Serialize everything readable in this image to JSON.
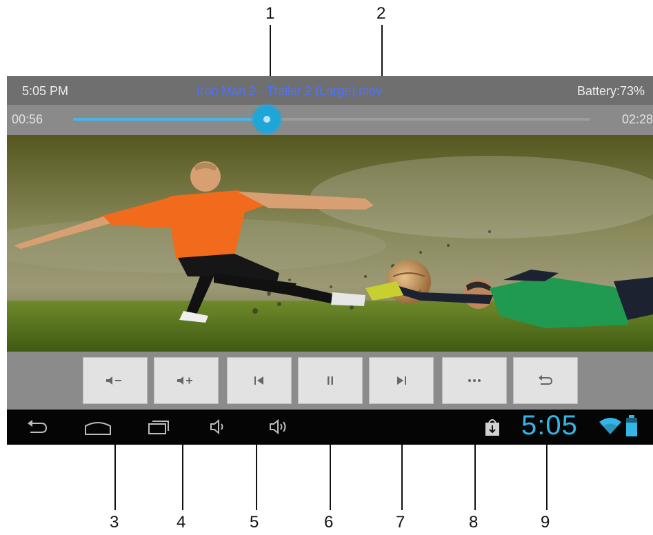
{
  "callouts": [
    "1",
    "2",
    "3",
    "4",
    "5",
    "6",
    "7",
    "8",
    "9"
  ],
  "status_bar": {
    "time": "5:05 PM",
    "title": "Iron Man 2 - Trailer 2 (Large).mov",
    "battery": "Battery:73%"
  },
  "progress": {
    "elapsed": "00:56",
    "total": "02:28",
    "fraction": 0.375
  },
  "controls": [
    {
      "name": "volume-down-button",
      "icon": "volume-down-icon",
      "glyph": "◀−"
    },
    {
      "name": "volume-up-button",
      "icon": "volume-up-icon",
      "glyph": "◀+"
    },
    {
      "name": "previous-button",
      "icon": "skip-previous-icon",
      "glyph": "|◀"
    },
    {
      "name": "pause-button",
      "icon": "pause-icon",
      "glyph": "||"
    },
    {
      "name": "next-button",
      "icon": "skip-next-icon",
      "glyph": "▶|"
    },
    {
      "name": "more-button",
      "icon": "more-icon",
      "glyph": "•••"
    },
    {
      "name": "return-button",
      "icon": "return-icon",
      "glyph": "↩"
    }
  ],
  "system_bar": {
    "clock": "5:05",
    "items": [
      "back-icon",
      "home-icon",
      "recent-apps-icon",
      "volume-down-icon",
      "volume-up-icon"
    ]
  },
  "colors": {
    "accent": "#33b5e5",
    "title": "#4e72ff",
    "pitch": "#5e7a1e",
    "jersey_orange": "#f26a1b",
    "jersey_green": "#1f9a50"
  }
}
